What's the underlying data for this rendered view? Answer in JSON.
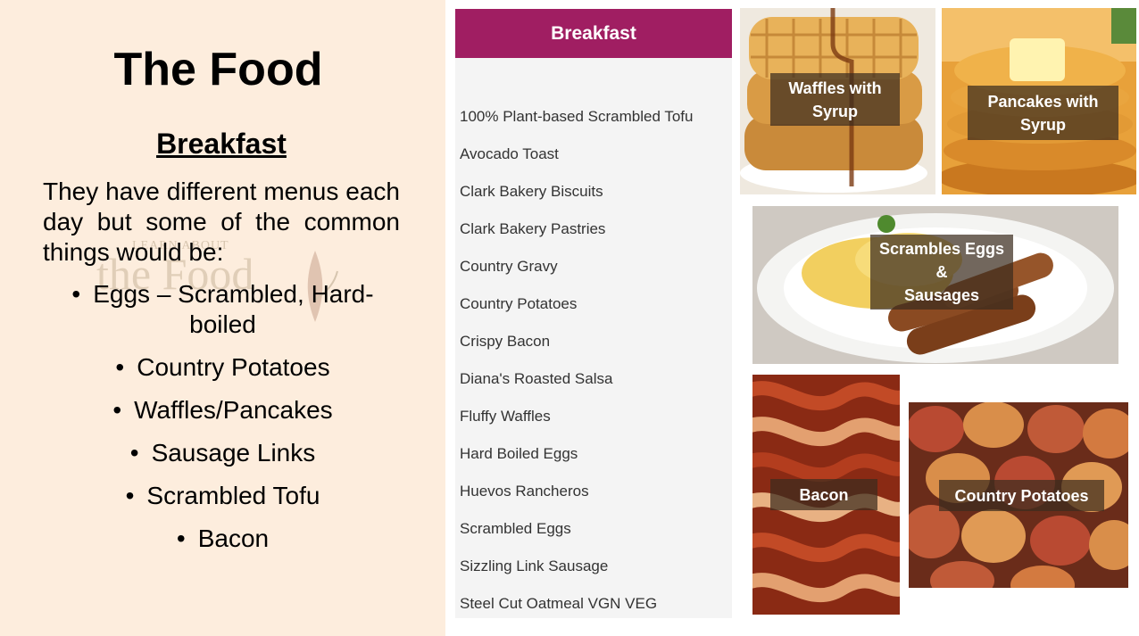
{
  "slide": {
    "title": "The Food",
    "subtitle": "Breakfast",
    "intro": "They have different menus each day but some of the common things would be:",
    "watermark_top": "LEARN ABOUT",
    "watermark_main": "the Food",
    "bullets": [
      "Eggs – Scrambled, Hard-boiled",
      "Country Potatoes",
      "Waffles/Pancakes",
      "Sausage Links",
      "Scrambled Tofu",
      "Bacon"
    ]
  },
  "menu": {
    "header": "Breakfast",
    "header_color": "#a01e62",
    "items": [
      "100% Plant-based Scrambled Tofu",
      "Avocado Toast",
      "Clark Bakery Biscuits",
      "Clark Bakery Pastries",
      "Country Gravy",
      "Country Potatoes",
      "Crispy Bacon",
      "Diana's Roasted Salsa",
      "Fluffy Waffles",
      "Hard Boiled Eggs",
      "Huevos Rancheros",
      "Scrambled Eggs",
      "Sizzling Link Sausage",
      "Steel Cut Oatmeal VGN VEG"
    ]
  },
  "photos": {
    "waffles": "Waffles with\nSyrup",
    "pancakes": "Pancakes with\nSyrup",
    "eggs_sausages": "Scrambles Eggs\n&\nSausages",
    "bacon": "Bacon",
    "potatoes": "Country Potatoes"
  }
}
